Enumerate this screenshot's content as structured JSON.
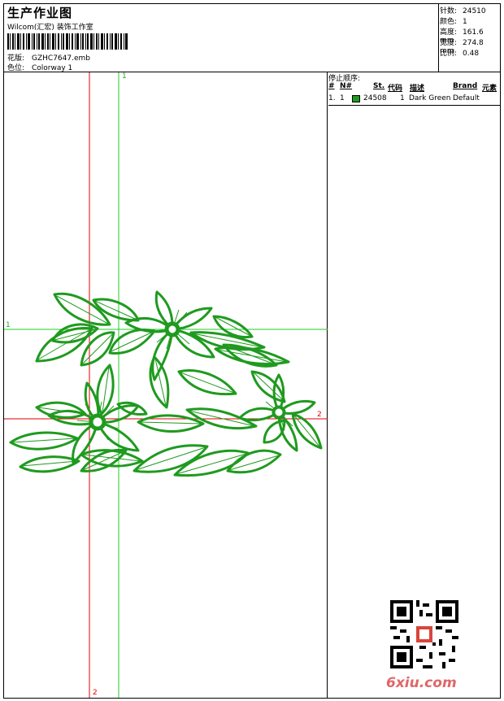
{
  "header": {
    "title": "生产作业图",
    "company": "Wilcom(汇宏) 装饰工作室",
    "design_label": "花版:",
    "design_value": "GZHC7647.emb",
    "colorway_label": "色位:",
    "colorway_value": "Colorway 1"
  },
  "stats": [
    {
      "label": "针数:",
      "value": "24510"
    },
    {
      "label": "颜色:",
      "value": "1"
    },
    {
      "label": "高度:",
      "value": "161.6 mm"
    },
    {
      "label": "宽度:",
      "value": "274.8 mm"
    },
    {
      "label": "比例:",
      "value": "0.48"
    }
  ],
  "stop_sequence": {
    "title": "停止顺序:",
    "columns": [
      "#",
      "N#",
      "St.",
      "代码",
      "描述",
      "Brand",
      "元素"
    ],
    "rows": [
      {
        "index": "1.",
        "n": "1",
        "code": "24508",
        "st": "1",
        "desc": "Dark Green",
        "brand": "Default",
        "color": "#1f9a1f"
      }
    ]
  },
  "markers": {
    "one": "1",
    "two": "2"
  },
  "watermark": "6xiu.com",
  "colors": {
    "thread": "#1f9a1f",
    "red_guide": "#e00000",
    "green_guide": "#22cc22",
    "watermark": "#e06666"
  }
}
